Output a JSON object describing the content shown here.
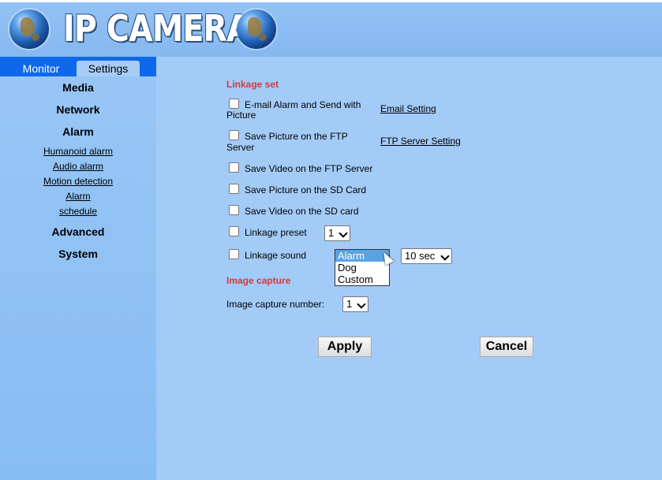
{
  "header": {
    "title": "IP CAMERA"
  },
  "tabs": {
    "monitor": "Monitor",
    "settings": "Settings"
  },
  "sidebar": {
    "media": "Media",
    "network": "Network",
    "alarm": "Alarm",
    "alarm_items": [
      "Humanoid alarm",
      "Audio alarm",
      "Motion detection",
      "Alarm",
      "schedule"
    ],
    "advanced": "Advanced",
    "system": "System"
  },
  "linkage": {
    "title": "Linkage set",
    "email_line1": "E-mail Alarm and Send with",
    "email_line2": "Picture",
    "email_link": "Email Setting",
    "ftp_pic_line1": "Save Picture on the FTP",
    "ftp_pic_line2": "Server",
    "ftp_link": "FTP Server Setting",
    "ftp_video": "Save Video on the FTP Server",
    "sd_pic": "Save Picture on the SD Card",
    "sd_video": "Save Video on the SD card",
    "preset_label": "Linkage preset",
    "preset_value": "1",
    "sound_label": "Linkage sound",
    "sound_options": [
      "Alarm",
      "Dog",
      "Custom"
    ],
    "sound_selected": "Alarm",
    "duration_value": "10 sec"
  },
  "capture": {
    "title": "Image capture",
    "number_label": "Image capture number:",
    "number_value": "1"
  },
  "buttons": {
    "apply": "Apply",
    "cancel": "Cancel"
  }
}
